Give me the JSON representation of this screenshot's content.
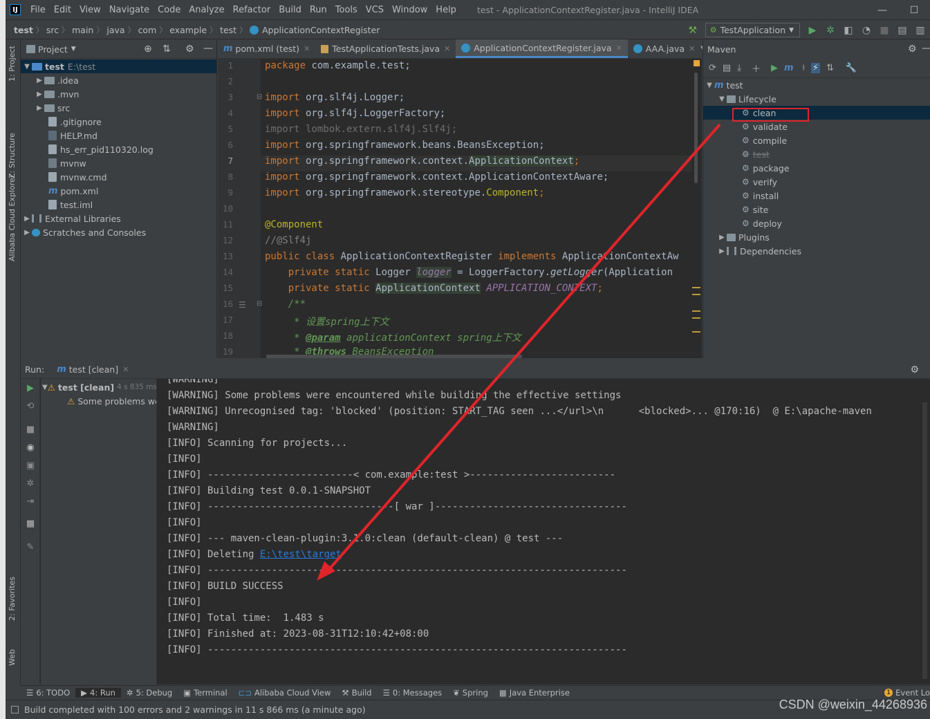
{
  "menubar": {
    "app_icon": "intellij-icon",
    "items": [
      "File",
      "Edit",
      "View",
      "Navigate",
      "Code",
      "Analyze",
      "Refactor",
      "Build",
      "Run",
      "Tools",
      "VCS",
      "Window",
      "Help"
    ],
    "window_title": "test - ApplicationContextRegister.java - IntelliJ IDEA"
  },
  "navbar": {
    "breadcrumbs": [
      "test",
      "src",
      "main",
      "java",
      "com",
      "example",
      "test",
      "ApplicationContextRegister"
    ],
    "run_config": "TestApplication"
  },
  "left_tool_strip": [
    "1: Project",
    "Z: Structure",
    "Alibaba Cloud Explorer",
    "2: Favorites",
    "Web"
  ],
  "project": {
    "header": "Project",
    "root_name": "test",
    "root_path": "E:\\test",
    "items": [
      ".idea",
      ".mvn",
      "src",
      ".gitignore",
      "HELP.md",
      "hs_err_pid110320.log",
      "mvnw",
      "mvnw.cmd",
      "pom.xml",
      "test.iml",
      "External Libraries",
      "Scratches and Consoles"
    ]
  },
  "editor": {
    "tabs": [
      "pom.xml (test)",
      "TestApplicationTests.java",
      "ApplicationContextRegister.java",
      "AAA.java"
    ],
    "line_numbers": [
      "1",
      "2",
      "3",
      "4",
      "5",
      "6",
      "7",
      "8",
      "9",
      "10",
      "11",
      "12",
      "13",
      "14",
      "15",
      "16",
      "17",
      "18",
      "19"
    ],
    "code": {
      "l1a": "package",
      "l1b": " com.example.test;",
      "kw_import": "import",
      "l3": " org.slf4j.Logger;",
      "l4": " org.slf4j.LoggerFactory;",
      "l5": "import lombok.extern.slf4j.Slf4j;",
      "l6": " org.springframework.beans.BeansException;",
      "l7a": " org.springframework.context.",
      "l7b": "ApplicationContext",
      "l7c": ";",
      "l8": " org.springframework.context.ApplicationContextAware;",
      "l9a": " org.springframework.stereotype.",
      "l9b": "Component",
      "l9c": ";",
      "l11": "@Component",
      "l12": "//@Slf4j",
      "l13a": "public class",
      "l13b": " ApplicationContextRegister ",
      "l13c": "implements",
      "l13d": " ApplicationContextAw",
      "l14a": "    private static",
      "l14b": " Logger ",
      "l14c": "logger",
      "l14d": " = LoggerFactory.",
      "l14e": "getLogger",
      "l14f": "(Application",
      "l15a": "    private static",
      "l15b": "ApplicationContext",
      "l15c": "APPLICATION_CONTEXT",
      "l15d": ";",
      "l16": "    /**",
      "l17": "     * 设置spring上下文",
      "l18a": "     * ",
      "l18b": "@param",
      "l18c": " applicationContext spring上下文",
      "l19a": "     * ",
      "l19b": "@throws",
      "l19c": " BeansException"
    }
  },
  "maven": {
    "header": "Maven",
    "root": "test",
    "lifecycle_label": "Lifecycle",
    "lifecycle": [
      "clean",
      "validate",
      "compile",
      "test",
      "package",
      "verify",
      "install",
      "site",
      "deploy"
    ],
    "plugins": "Plugins",
    "dependencies": "Dependencies"
  },
  "run": {
    "label": "Run:",
    "tab": "test [clean]",
    "tree_root": "test [clean]",
    "tree_root_time": "4 s 835 ms",
    "tree_child": "Some problems we",
    "console": [
      "[WARNING]",
      "[WARNING] Some problems were encountered while building the effective settings",
      "[WARNING] Unrecognised tag: 'blocked' (position: START_TAG seen ...</url>\\n      <blocked>... @170:16)  @ E:\\apache-maven",
      "[WARNING]",
      "[INFO] Scanning for projects...",
      "[INFO]",
      "[INFO] -------------------------< com.example:test >-------------------------",
      "[INFO] Building test 0.0.1-SNAPSHOT",
      "[INFO] --------------------------------[ war ]---------------------------------",
      "[INFO]",
      "[INFO] --- maven-clean-plugin:3.1.0:clean (default-clean) @ test ---",
      "[INFO] Deleting ",
      "[INFO] ------------------------------------------------------------------------",
      "[INFO] BUILD SUCCESS",
      "[INFO] ------------------------------------------------------------------------",
      "[INFO] Total time:  1.483 s",
      "[INFO] Finished at: 2023-08-31T12:10:42+08:00",
      "[INFO] ------------------------------------------------------------------------"
    ],
    "deleting_path": "E:\\test\\target"
  },
  "bottom_tabs": [
    "6: TODO",
    "4: Run",
    "5: Debug",
    "Terminal",
    "Alibaba Cloud View",
    "Build",
    "0: Messages",
    "Spring",
    "Java Enterprise",
    "Event Lo"
  ],
  "status": "Build completed with 100 errors and 2 warnings in 11 s 866 ms (a minute ago)",
  "watermark": "CSDN @weixin_44268936",
  "colors": {
    "annotation": "#e0242a",
    "accent": "#4a88c7",
    "warning": "#e8a838"
  }
}
